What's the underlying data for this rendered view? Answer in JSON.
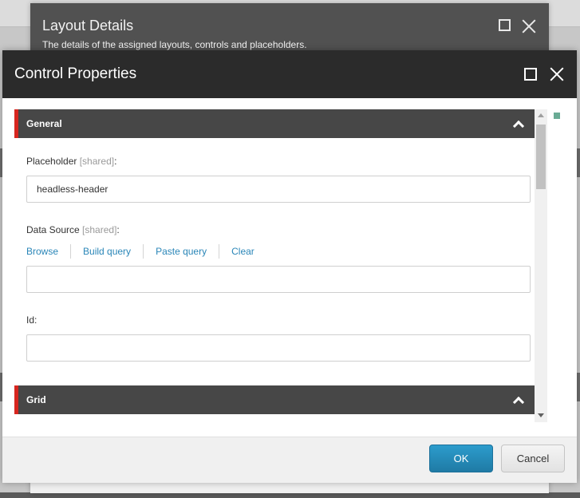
{
  "background_dialog": {
    "title": "Layout Details",
    "subtitle": "The details of the assigned layouts, controls and placeholders.",
    "maximize_icon": "maximize-icon",
    "close_icon": "close-icon"
  },
  "dialog": {
    "title": "Control Properties",
    "maximize_icon": "maximize-icon",
    "close_icon": "close-icon",
    "sections": [
      {
        "title": "General",
        "expanded": true,
        "toggle_icon": "chevron-up-icon"
      },
      {
        "title": "Grid",
        "expanded": true,
        "toggle_icon": "chevron-up-icon"
      }
    ],
    "fields": {
      "placeholder": {
        "label": "Placeholder",
        "shared": "[shared]",
        "suffix": ":",
        "value": "headless-header"
      },
      "data_source": {
        "label": "Data Source",
        "shared": "[shared]",
        "suffix": ":",
        "value": ""
      },
      "id": {
        "label": "Id:",
        "value": ""
      }
    },
    "data_source_links": [
      "Browse",
      "Build query",
      "Paste query",
      "Clear"
    ],
    "footer": {
      "ok_label": "OK",
      "cancel_label": "Cancel"
    }
  },
  "colors": {
    "accent_red": "#d7261f",
    "link_blue": "#2a86b8",
    "ok_blue": "#2589b8",
    "header_dark": "#2b2b2b",
    "section_dark": "#474747",
    "status_green": "#6aab95"
  }
}
